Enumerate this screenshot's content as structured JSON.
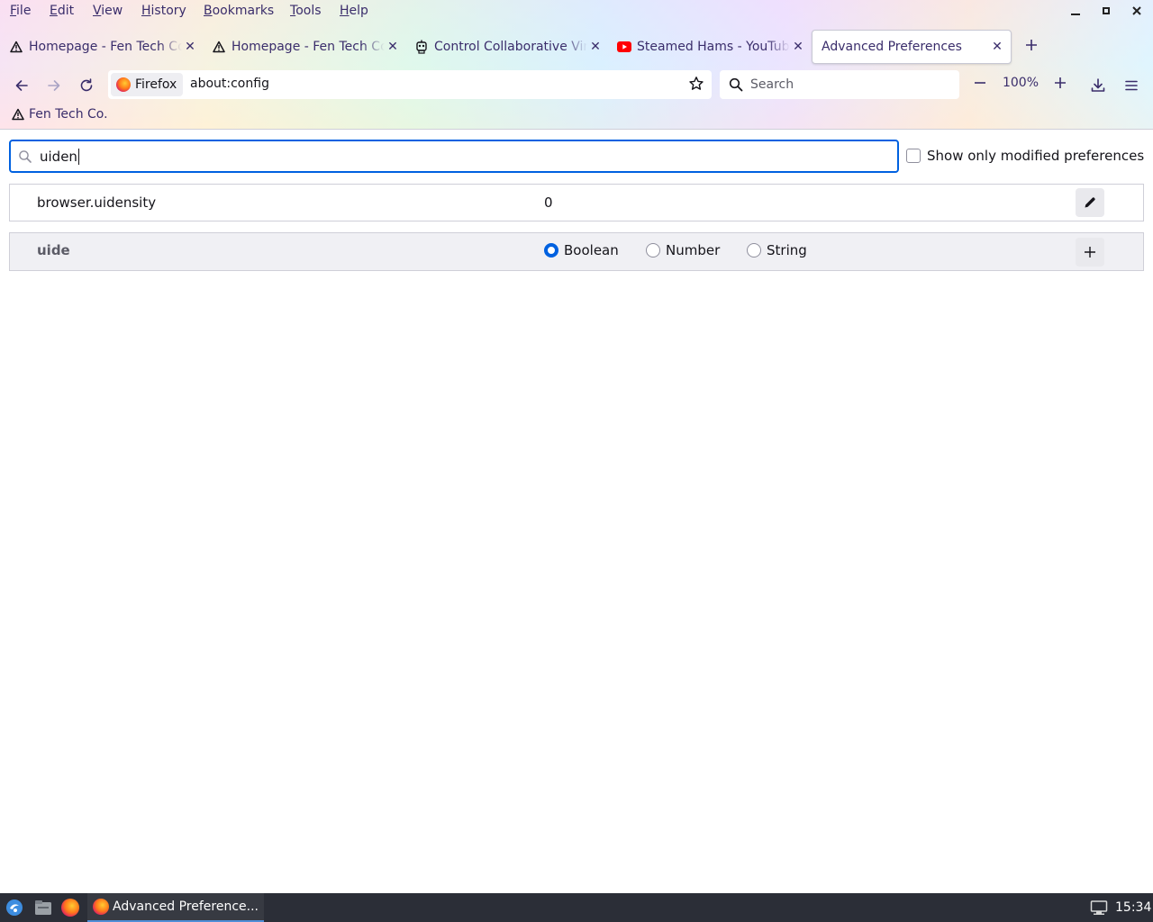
{
  "menubar": {
    "items": [
      {
        "label": "File"
      },
      {
        "label": "Edit"
      },
      {
        "label": "View"
      },
      {
        "label": "History"
      },
      {
        "label": "Bookmarks"
      },
      {
        "label": "Tools"
      },
      {
        "label": "Help"
      }
    ]
  },
  "tabs": [
    {
      "title": "Homepage - Fen Tech Co.",
      "icon": "warning-triangle-icon",
      "active": false
    },
    {
      "title": "Homepage - Fen Tech Co.",
      "icon": "warning-triangle-icon",
      "active": false
    },
    {
      "title": "Control Collaborative Virtual",
      "icon": "robot-icon",
      "active": false
    },
    {
      "title": "Steamed Hams - YouTube",
      "icon": "youtube-icon",
      "active": false
    },
    {
      "title": "Advanced Preferences",
      "icon": "",
      "active": true
    }
  ],
  "navbar": {
    "identity_label": "Firefox",
    "url": "about:config",
    "search_placeholder": "Search",
    "zoom_level": "100%"
  },
  "bookmarks": [
    {
      "label": "Fen Tech Co.",
      "icon": "warning-triangle-icon"
    }
  ],
  "config": {
    "search_value": "uiden",
    "show_modified_label": "Show only modified preferences",
    "show_modified_checked": false,
    "prefs": [
      {
        "name": "browser.uidensity",
        "value": "0"
      }
    ],
    "new_pref": {
      "name": "uide",
      "types": [
        "Boolean",
        "Number",
        "String"
      ],
      "selected_type": "Boolean"
    }
  },
  "taskbar": {
    "task_label": "Advanced Preference...",
    "clock": "15:34"
  },
  "colors": {
    "accent": "#0061e0",
    "menu_text": "#3a2d6b",
    "taskbar_bg": "#2b2e37"
  }
}
